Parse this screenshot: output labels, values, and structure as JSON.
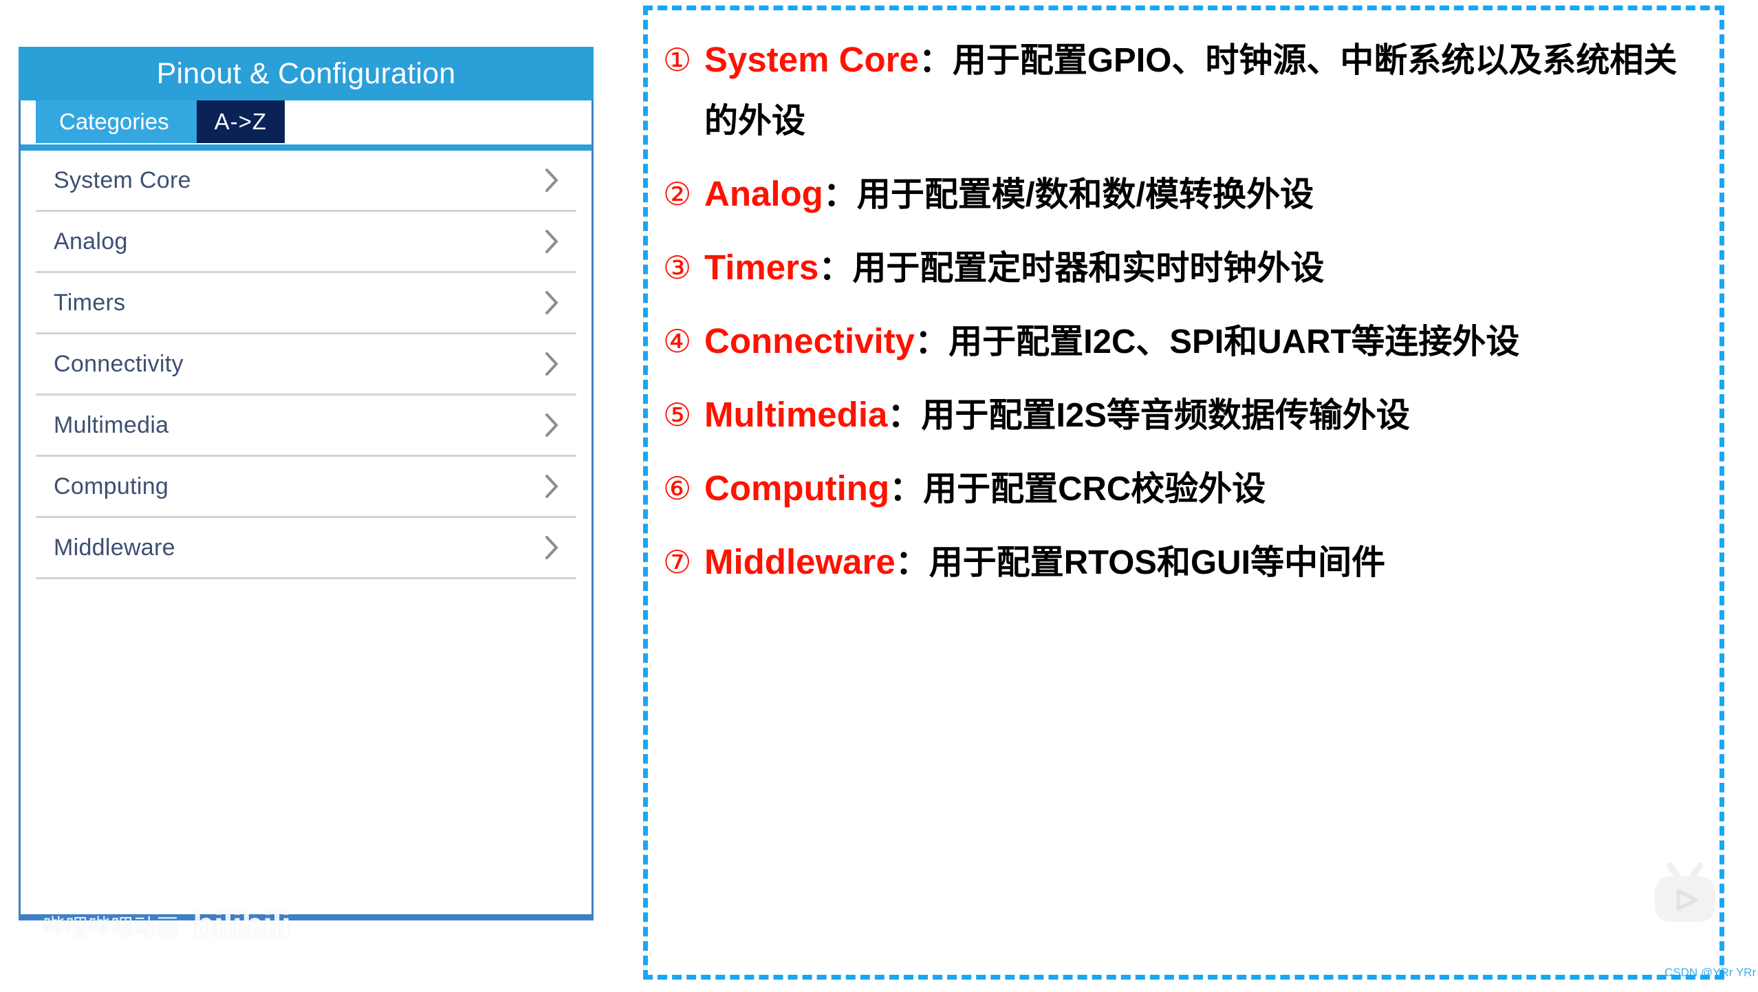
{
  "left_panel": {
    "header_title": "Pinout & Configuration",
    "tabs": [
      {
        "label": "Categories",
        "selected": true,
        "style": "light"
      },
      {
        "label": "A->Z",
        "selected": false,
        "style": "dark"
      }
    ],
    "categories": [
      {
        "label": "System Core"
      },
      {
        "label": "Analog"
      },
      {
        "label": "Timers"
      },
      {
        "label": "Connectivity"
      },
      {
        "label": "Multimedia"
      },
      {
        "label": "Computing"
      },
      {
        "label": "Middleware"
      }
    ],
    "chevron_icon": "chevron-right-icon"
  },
  "right_panel": {
    "notes": [
      {
        "number": "①",
        "keyword": "System Core",
        "separator": "：",
        "description": "用于配置GPIO、时钟源、中断系统以及系统相关的外设"
      },
      {
        "number": "②",
        "keyword": "Analog",
        "separator": "：",
        "description": "用于配置模/数和数/模转换外设"
      },
      {
        "number": "③",
        "keyword": "Timers",
        "separator": "：",
        "description": "用于配置定时器和实时时钟外设"
      },
      {
        "number": "④",
        "keyword": "Connectivity",
        "separator": "：",
        "description": "用于配置I2C、SPI和UART等连接外设"
      },
      {
        "number": "⑤",
        "keyword": "Multimedia",
        "separator": "：",
        "description": "用于配置I2S等音频数据传输外设"
      },
      {
        "number": "⑥",
        "keyword": "Computing",
        "separator": "：",
        "description": "用于配置CRC校验外设"
      },
      {
        "number": "⑦",
        "keyword": "Middleware",
        "separator": "：",
        "description": "用于配置RTOS和GUI等中间件"
      }
    ]
  },
  "watermarks": {
    "bilibili_text": "哔哩哔哩动画",
    "bilibili_logo": "bilibili",
    "tv_icon": "bilibili-tv-play-icon",
    "csdn": "CSDN @YRr YRr"
  },
  "colors": {
    "header_blue": "#2a9fd8",
    "tab_light_blue": "#35a7e0",
    "tab_dark_navy": "#0b2257",
    "panel_border_blue": "#3e80c8",
    "dashed_border_blue": "#17a7f5",
    "keyword_red": "#ff1200",
    "list_text_navy": "#3d4f72",
    "divider_gray": "#cfd4da"
  }
}
